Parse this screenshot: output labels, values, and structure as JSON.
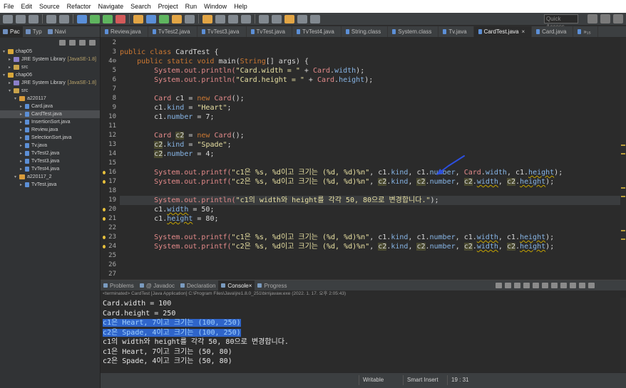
{
  "menubar": [
    "File",
    "Edit",
    "Source",
    "Refactor",
    "Navigate",
    "Search",
    "Project",
    "Run",
    "Window",
    "Help"
  ],
  "toolbar": {
    "quick_access_placeholder": "Quick Access"
  },
  "left_tabs": [
    "Pac",
    "Typ",
    "Navi"
  ],
  "tree": [
    {
      "label": "chap05",
      "extra": "",
      "icon": "project-icon",
      "type": "project",
      "indent": 0,
      "arrow": "▾"
    },
    {
      "label": "JRE System Library",
      "extra": "[JavaSE-1.8]",
      "icon": "library-icon",
      "type": "library",
      "indent": 1,
      "arrow": "▸"
    },
    {
      "label": "src",
      "extra": "",
      "icon": "folder-icon",
      "type": "folder",
      "indent": 1,
      "arrow": "▸"
    },
    {
      "label": "chap06",
      "extra": "",
      "icon": "project-icon",
      "type": "project",
      "indent": 0,
      "arrow": "▾"
    },
    {
      "label": "JRE System Library",
      "extra": "[JavaSE-1.8]",
      "icon": "library-icon",
      "type": "library",
      "indent": 1,
      "arrow": "▸"
    },
    {
      "label": "src",
      "extra": "",
      "icon": "folder-icon",
      "type": "folder",
      "indent": 1,
      "arrow": "▾"
    },
    {
      "label": "a220117",
      "extra": "",
      "icon": "package-icon",
      "type": "package",
      "indent": 2,
      "arrow": "▾"
    },
    {
      "label": "Card.java",
      "extra": "",
      "icon": "java-file-icon",
      "type": "java",
      "indent": 3,
      "arrow": "▸"
    },
    {
      "label": "CardTest.java",
      "extra": "",
      "icon": "java-file-icon",
      "type": "java",
      "indent": 3,
      "arrow": "▸",
      "selected": true
    },
    {
      "label": "InsertionSort.java",
      "extra": "",
      "icon": "java-file-icon",
      "type": "java",
      "indent": 3,
      "arrow": "▸"
    },
    {
      "label": "Review.java",
      "extra": "",
      "icon": "java-file-icon",
      "type": "java",
      "indent": 3,
      "arrow": "▸"
    },
    {
      "label": "SelectionSort.java",
      "extra": "",
      "icon": "java-file-icon",
      "type": "java",
      "indent": 3,
      "arrow": "▸"
    },
    {
      "label": "Tv.java",
      "extra": "",
      "icon": "java-file-icon",
      "type": "java",
      "indent": 3,
      "arrow": "▸"
    },
    {
      "label": "TvTest2.java",
      "extra": "",
      "icon": "java-file-icon",
      "type": "java",
      "indent": 3,
      "arrow": "▸"
    },
    {
      "label": "TvTest3.java",
      "extra": "",
      "icon": "java-file-icon",
      "type": "java",
      "indent": 3,
      "arrow": "▸"
    },
    {
      "label": "TvTest4.java",
      "extra": "",
      "icon": "java-file-icon",
      "type": "java",
      "indent": 3,
      "arrow": "▸"
    },
    {
      "label": "a220117_2",
      "extra": "",
      "icon": "package-icon",
      "type": "package",
      "indent": 2,
      "arrow": "▾"
    },
    {
      "label": "TvTest.java",
      "extra": "",
      "icon": "java-file-icon",
      "type": "java",
      "indent": 3,
      "arrow": "▸"
    }
  ],
  "editor_tabs": [
    {
      "label": "Review.java"
    },
    {
      "label": "TvTest2.java"
    },
    {
      "label": "TvTest3.java"
    },
    {
      "label": "TvTest.java"
    },
    {
      "label": "TvTest4.java"
    },
    {
      "label": "String.class"
    },
    {
      "label": "System.class"
    },
    {
      "label": "Tv.java"
    },
    {
      "label": "CardTest.java",
      "active": true,
      "close": "×"
    },
    {
      "label": "Card.java"
    },
    {
      "label": "»₁₅"
    }
  ],
  "editor": {
    "current_line": 19,
    "lines": [
      {
        "n": "2",
        "t": []
      },
      {
        "n": "3",
        "t": [
          [
            "kw",
            "public class "
          ],
          [
            "ident",
            "CardTest {"
          ]
        ]
      },
      {
        "n": "4⊖",
        "t": [
          [
            "kw",
            "    public static void "
          ],
          [
            "ident",
            "main("
          ],
          [
            "kw",
            "String"
          ],
          [
            "ident",
            "[] args) {"
          ]
        ]
      },
      {
        "n": "5",
        "t": [
          [
            "sys",
            "        System.out.println("
          ],
          [
            "str",
            "\"Card.width = \""
          ],
          [
            "ident",
            " + "
          ],
          [
            "sys",
            "Card"
          ],
          [
            "ident",
            "."
          ],
          [
            "fld",
            "width"
          ],
          [
            "ident",
            ");"
          ]
        ]
      },
      {
        "n": "6",
        "t": [
          [
            "sys",
            "        System.out.println("
          ],
          [
            "str",
            "\"Card.height = \""
          ],
          [
            "ident",
            " + "
          ],
          [
            "sys",
            "Card"
          ],
          [
            "ident",
            "."
          ],
          [
            "fld",
            "height"
          ],
          [
            "ident",
            ");"
          ]
        ]
      },
      {
        "n": "7",
        "t": []
      },
      {
        "n": "8",
        "t": [
          [
            "sys",
            "        Card "
          ],
          [
            "ident",
            "c1 = "
          ],
          [
            "kw",
            "new "
          ],
          [
            "sys",
            "Card"
          ],
          [
            "ident",
            "();"
          ]
        ]
      },
      {
        "n": "9",
        "t": [
          [
            "ident",
            "        c1."
          ],
          [
            "fld",
            "kind"
          ],
          [
            "ident",
            " = "
          ],
          [
            "str",
            "\"Heart\""
          ],
          [
            "ident",
            ";"
          ]
        ]
      },
      {
        "n": "10",
        "t": [
          [
            "ident",
            "        c1."
          ],
          [
            "fld",
            "number"
          ],
          [
            "ident",
            " = 7;"
          ]
        ]
      },
      {
        "n": "11",
        "t": []
      },
      {
        "n": "12",
        "t": [
          [
            "sys",
            "        Card "
          ],
          [
            "hlv",
            "c2"
          ],
          [
            "ident",
            " = "
          ],
          [
            "kw",
            "new "
          ],
          [
            "sys",
            "Card"
          ],
          [
            "ident",
            "();"
          ]
        ]
      },
      {
        "n": "13",
        "t": [
          [
            "ident",
            "        "
          ],
          [
            "hlv",
            "c2"
          ],
          [
            "ident",
            "."
          ],
          [
            "fld",
            "kind"
          ],
          [
            "ident",
            " = "
          ],
          [
            "str",
            "\"Spade\""
          ],
          [
            "ident",
            ";"
          ]
        ]
      },
      {
        "n": "14",
        "t": [
          [
            "ident",
            "        "
          ],
          [
            "hlv",
            "c2"
          ],
          [
            "ident",
            "."
          ],
          [
            "fld",
            "number"
          ],
          [
            "ident",
            " = 4;"
          ]
        ]
      },
      {
        "n": "15",
        "t": []
      },
      {
        "n": "16",
        "mark": true,
        "t": [
          [
            "sys",
            "        System.out.printf("
          ],
          [
            "str",
            "\"c1은 %s, %d이고 크기는 (%d, %d)%n\""
          ],
          [
            "ident",
            ", c1."
          ],
          [
            "fld",
            "kind"
          ],
          [
            "ident",
            ", c1."
          ],
          [
            "fld",
            "number"
          ],
          [
            "ident",
            ", "
          ],
          [
            "sys",
            "Card"
          ],
          [
            "ident",
            "."
          ],
          [
            "fld",
            "width"
          ],
          [
            "ident",
            ", c1."
          ],
          [
            "sq",
            "height"
          ],
          [
            "ident",
            ");"
          ]
        ]
      },
      {
        "n": "17",
        "mark": true,
        "t": [
          [
            "sys",
            "        System.out.printf("
          ],
          [
            "str",
            "\"c2은 %s, %d이고 크기는 (%d, %d)%n\""
          ],
          [
            "ident",
            ", "
          ],
          [
            "hlv",
            "c2"
          ],
          [
            "ident",
            "."
          ],
          [
            "fld",
            "kind"
          ],
          [
            "ident",
            ", "
          ],
          [
            "hlv",
            "c2"
          ],
          [
            "ident",
            "."
          ],
          [
            "fld",
            "number"
          ],
          [
            "ident",
            ", "
          ],
          [
            "hlv",
            "c2"
          ],
          [
            "ident",
            "."
          ],
          [
            "sq",
            "width"
          ],
          [
            "ident",
            ", "
          ],
          [
            "hlv",
            "c2"
          ],
          [
            "ident",
            "."
          ],
          [
            "sq",
            "height"
          ],
          [
            "ident",
            ");"
          ]
        ]
      },
      {
        "n": "18",
        "t": []
      },
      {
        "n": "19",
        "t": [
          [
            "sys",
            "        System.out.println("
          ],
          [
            "str",
            "\"c1의 width와 height를 각각 50, 80으로 변경합니다.\""
          ],
          [
            "ident",
            ");"
          ]
        ]
      },
      {
        "n": "20",
        "mark": true,
        "t": [
          [
            "ident",
            "        c1."
          ],
          [
            "sq",
            "width"
          ],
          [
            "ident",
            " = 50;"
          ]
        ]
      },
      {
        "n": "21",
        "mark": true,
        "t": [
          [
            "ident",
            "        c1."
          ],
          [
            "sq",
            "height"
          ],
          [
            "ident",
            " = 80;"
          ]
        ]
      },
      {
        "n": "22",
        "t": []
      },
      {
        "n": "23",
        "mark": true,
        "t": [
          [
            "sys",
            "        System.out.printf("
          ],
          [
            "str",
            "\"c1은 %s, %d이고 크기는 (%d, %d)%n\""
          ],
          [
            "ident",
            ", c1."
          ],
          [
            "fld",
            "kind"
          ],
          [
            "ident",
            ", c1."
          ],
          [
            "fld",
            "number"
          ],
          [
            "ident",
            ", c1."
          ],
          [
            "sq",
            "width"
          ],
          [
            "ident",
            ", c1."
          ],
          [
            "sq",
            "height"
          ],
          [
            "ident",
            ");"
          ]
        ]
      },
      {
        "n": "24",
        "mark": true,
        "t": [
          [
            "sys",
            "        System.out.printf("
          ],
          [
            "str",
            "\"c2은 %s, %d이고 크기는 (%d, %d)%n\""
          ],
          [
            "ident",
            ", "
          ],
          [
            "hlv",
            "c2"
          ],
          [
            "ident",
            "."
          ],
          [
            "fld",
            "kind"
          ],
          [
            "ident",
            ", "
          ],
          [
            "hlv",
            "c2"
          ],
          [
            "ident",
            "."
          ],
          [
            "fld",
            "number"
          ],
          [
            "ident",
            ", "
          ],
          [
            "hlv",
            "c2"
          ],
          [
            "ident",
            "."
          ],
          [
            "sq",
            "width"
          ],
          [
            "ident",
            ", "
          ],
          [
            "hlv",
            "c2"
          ],
          [
            "ident",
            "."
          ],
          [
            "sq",
            "height"
          ],
          [
            "ident",
            ");"
          ]
        ]
      },
      {
        "n": "25",
        "t": []
      },
      {
        "n": "26",
        "t": []
      },
      {
        "n": "27",
        "t": []
      }
    ]
  },
  "bottom": {
    "tabs": [
      {
        "label": "Problems"
      },
      {
        "label": "@ Javadoc"
      },
      {
        "label": "Declaration"
      },
      {
        "label": "Console",
        "active": true,
        "close": "×"
      },
      {
        "label": "Progress"
      }
    ],
    "console_header": "<terminated> CardTest [Java Application] C:\\Program Files\\Java\\jre1.8.0_251\\bin\\javaw.exe (2022. 1. 17. 오후 2:05:43)",
    "output": [
      {
        "text": "Card.width = 100"
      },
      {
        "text": "Card.height = 250"
      },
      {
        "text": "c1은 Heart, 7이고 크기는 (100, 250)",
        "selected": true
      },
      {
        "text": "c2은 Spade, 4이고 크기는 (100, 250)",
        "selected": true
      },
      {
        "text": "c1의 width와 height를 각각 50, 80으로 변경합니다."
      },
      {
        "text": "c1은 Heart, 7이고 크기는 (50, 80)"
      },
      {
        "text": "c2은 Spade, 4이고 크기는 (50, 80)"
      }
    ]
  },
  "status": {
    "writable": "Writable",
    "insert_mode": "Smart Insert",
    "position": "19 : 31"
  },
  "colors": {
    "background": "#2b2b2b",
    "keyword": "#cc7832",
    "string": "#e8e0a2",
    "type": "#e48a8a",
    "field": "#87b5e6",
    "selection": "#2f65ca",
    "annotation": "#2c4fe0"
  }
}
